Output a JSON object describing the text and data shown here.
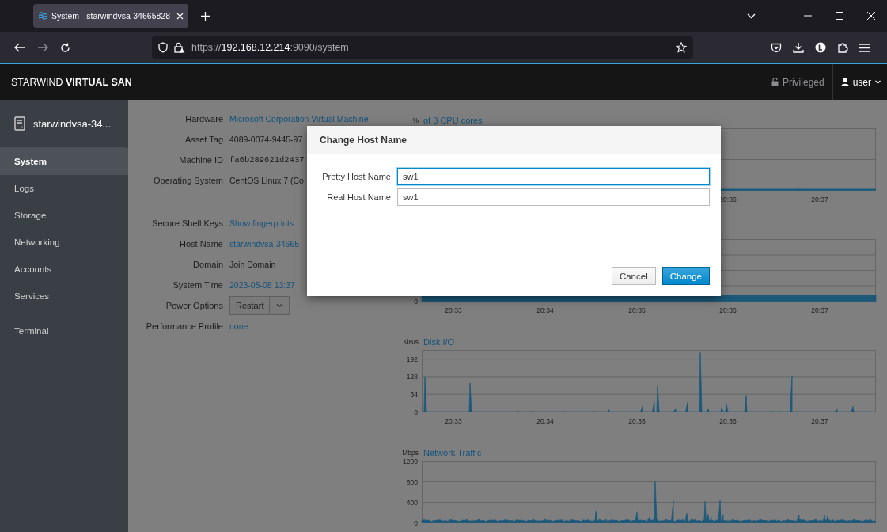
{
  "browser": {
    "tab_title": "System - starwindvsa-34665828",
    "url": "https://**192.168.12.214**:9090/system"
  },
  "header": {
    "brand": "STARWIND **VIRTUAL SAN**",
    "privileged": "Privileged",
    "user": "user"
  },
  "sidebar": {
    "host": "starwindvsa-34...",
    "items": [
      {
        "label": "System",
        "selected": true
      },
      {
        "label": "Logs",
        "selected": false
      },
      {
        "label": "Storage",
        "selected": false
      },
      {
        "label": "Networking",
        "selected": false
      },
      {
        "label": "Accounts",
        "selected": false
      },
      {
        "label": "Services",
        "selected": false
      }
    ],
    "tools": [
      {
        "label": "Terminal",
        "selected": false
      }
    ]
  },
  "info_groups": [
    [
      {
        "label": "Hardware",
        "value": "Microsoft Corporation Virtual Machine",
        "kind": "link"
      },
      {
        "label": "Asset Tag",
        "value": "4089-0074-9445-97",
        "kind": "text"
      },
      {
        "label": "Machine ID",
        "value": "fa6b289621d2437",
        "kind": "mono"
      },
      {
        "label": "Operating System",
        "value": "CentOS Linux 7 (Co",
        "kind": "text"
      }
    ],
    [
      {
        "label": "Secure Shell Keys",
        "value": "Show fingerprints",
        "kind": "link"
      },
      {
        "label": "Host Name",
        "value": "starwindvsa-34665",
        "kind": "link"
      },
      {
        "label": "Domain",
        "value": "Join Domain",
        "kind": "text"
      },
      {
        "label": "System Time",
        "value": "2023-05-08 13:37",
        "kind": "link"
      },
      {
        "label": "Power Options",
        "value": "Restart",
        "kind": "split-button"
      },
      {
        "label": "Performance Profile",
        "value": "none",
        "kind": "link"
      }
    ]
  ],
  "charts": [
    {
      "kind": "cpu",
      "unit": "%",
      "title": "of 8 CPU cores",
      "x_labels": [
        "20:36",
        "20:37"
      ]
    },
    {
      "kind": "memory",
      "y_labels": [
        "0"
      ],
      "x_labels": [
        "20:33",
        "20:34",
        "20:35",
        "20:36",
        "20:37"
      ]
    },
    {
      "kind": "disk",
      "unit": "KiB/s",
      "title": "Disk I/O",
      "y_labels": [
        "192",
        "128",
        "64",
        "0"
      ],
      "x_labels": [
        "20:33",
        "20:34",
        "20:35",
        "20:36",
        "20:37"
      ]
    },
    {
      "kind": "network",
      "unit": "Mbps",
      "title": "Network Traffic",
      "y_labels": [
        "1200",
        "800",
        "400",
        "0"
      ]
    }
  ],
  "dialog": {
    "title": "Change Host Name",
    "fields": [
      {
        "label": "Pretty Host Name",
        "value": "sw1",
        "focused": true
      },
      {
        "label": "Real Host Name",
        "value": "sw1",
        "focused": false
      }
    ],
    "buttons": [
      {
        "label": "Cancel",
        "kind": "default"
      },
      {
        "label": "Change",
        "kind": "primary"
      }
    ]
  }
}
